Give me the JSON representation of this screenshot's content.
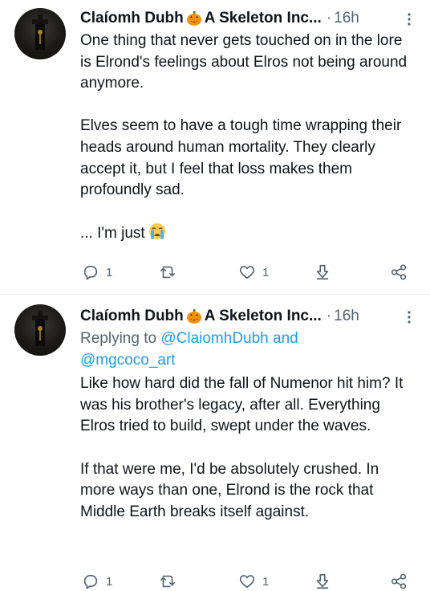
{
  "tweets": [
    {
      "author": "Claíomh Dubh",
      "org": "A Skeleton Inc...",
      "separator": "·",
      "time": "16h",
      "text": "One thing that never gets touched on in the lore is Elrond's feelings about Elros not being around anymore.\n\nElves seem to have a tough time wrapping their heads around human mortality. They clearly accept it, but I feel that loss makes them profoundly sad.\n\n... I'm just",
      "reply_count": "1",
      "retweet_count": "",
      "like_count": "1"
    },
    {
      "author": "Claíomh Dubh",
      "org": "A Skeleton Inc...",
      "separator": "·",
      "time": "16h",
      "replying_prefix": "Replying to",
      "mention_1": "@ClaiomhDubh",
      "replying_and": "and",
      "mention_2": "@mgcoco_art",
      "text": "Like how hard did the fall of Numenor hit him? It was his brother's legacy, after all. Everything Elros tried to build, swept under the waves.\n\nIf that were me, I'd be absolutely crushed. In more ways than one, Elrond is the rock that Middle Earth breaks itself against.",
      "reply_count": "1",
      "retweet_count": "",
      "like_count": "1"
    }
  ],
  "icons": {
    "emoji": "loudly-crying-face",
    "badge": "jack-o-lantern",
    "reply": "reply-icon",
    "retweet": "retweet-icon",
    "like": "like-icon",
    "download": "download-icon",
    "share": "share-icon",
    "more": "more-icon"
  },
  "colors": {
    "text": "#0f1419",
    "secondary": "#536471",
    "link": "#1d9bf0"
  }
}
